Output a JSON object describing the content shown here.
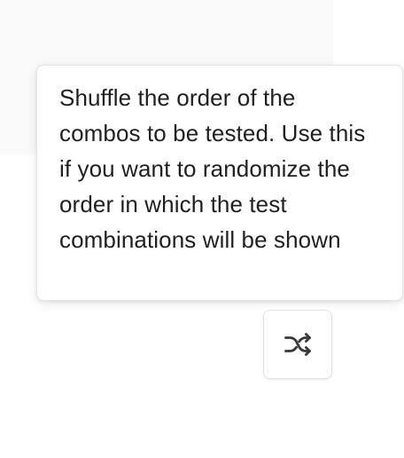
{
  "tooltip": {
    "text": "Shuffle the order of the combos to be tested. Use this if you want to randomize the order in which the test combinations will be shown"
  },
  "shuffle_button": {
    "icon": "shuffle-icon",
    "icon_color": "#3a3a3a"
  },
  "colors": {
    "background": "#ffffff",
    "panel": "#f9f9f9",
    "border": "#e3e3e3",
    "text": "#1f1f1f"
  }
}
